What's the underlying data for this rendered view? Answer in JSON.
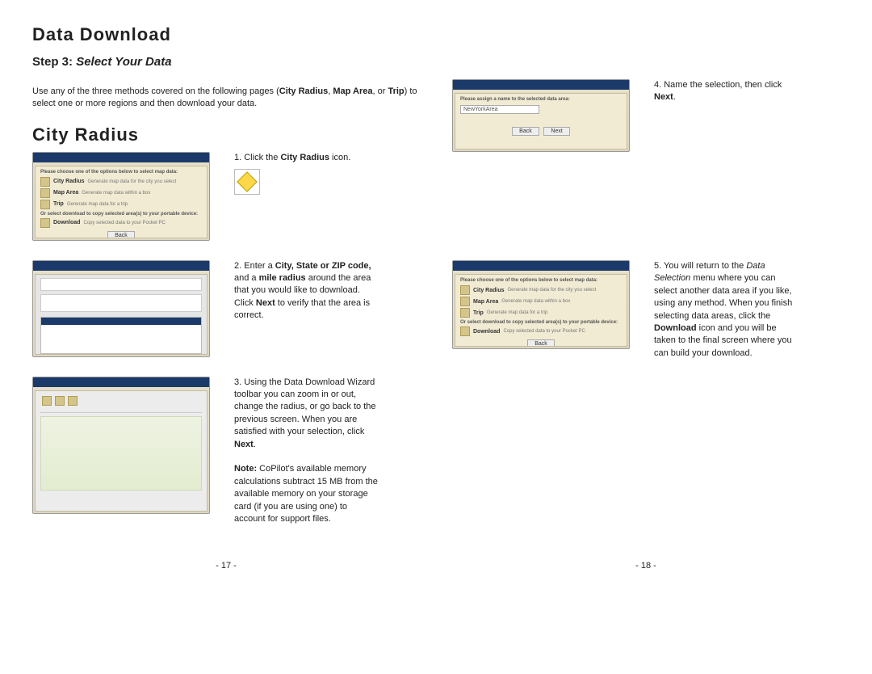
{
  "left": {
    "h1": "Data Download",
    "step_prefix": "Step 3:",
    "step_title": "Select Your Data",
    "intro_pre": "Use any of the three methods covered on the following pages (",
    "intro_b1": "City Radius",
    "intro_mid": ", ",
    "intro_b2": "Map Area",
    "intro_mid2": ", or ",
    "intro_b3": "Trip",
    "intro_post": ") to select one or more regions and then download your data.",
    "h1b": "City Radius",
    "s1_n": "1.  ",
    "s1_a": "Click the ",
    "s1_b": "City Radius",
    "s1_c": " icon.",
    "s2_n": "2.  ",
    "s2_a": "Enter a ",
    "s2_b": "City, State or ZIP code,",
    "s2_c": " and a ",
    "s2_d": "mile radius",
    "s2_e": " around the area that you would like to download.  Click ",
    "s2_f": "Next",
    "s2_g": " to verify that the area is correct.",
    "s3_n": "3.  ",
    "s3_a": "Using the Data Download Wizard toolbar you can zoom in or out, change the radius, or go back to the previous screen.  When you are satisfied with your selection, click ",
    "s3_b": "Next",
    "s3_c": ".",
    "s3_note_l": "Note:",
    "s3_note_t": "  CoPilot's available memory calculations subtract 15 MB from the available memory on your storage card (if you are using one) to account for support files.",
    "pagenum": "- 17 -"
  },
  "right": {
    "s4_n": "4.  ",
    "s4_a": "Name the selection, then click ",
    "s4_b": "Next",
    "s4_c": ".",
    "s5_n": "5.  ",
    "s5_a": "You will return to the ",
    "s5_i": "Data Selection",
    "s5_b": " menu where you can select another data area if you like, using any method.  When you finish selecting data areas, click the ",
    "s5_c": "Download",
    "s5_d": " icon and you will be taken to the final screen where you can build your download.",
    "pagenum": "- 18 -"
  },
  "shot": {
    "head": "Please choose one of the options below to select map data:",
    "opt1": "City Radius",
    "opt1d": "Generate map data for the city you select",
    "opt2": "Map Area",
    "opt2d": "Generate map data within a box",
    "opt3": "Trip",
    "opt3d": "Generate map data for a trip",
    "or": "Or select download to copy selected area(s) to your portable device:",
    "dl": "Download",
    "dld": "Copy selected data to your Pocket PC",
    "back": "Back",
    "next": "Next",
    "namehead": "Please assign a name to the selected data area:",
    "nameval": "NewYorkArea"
  }
}
